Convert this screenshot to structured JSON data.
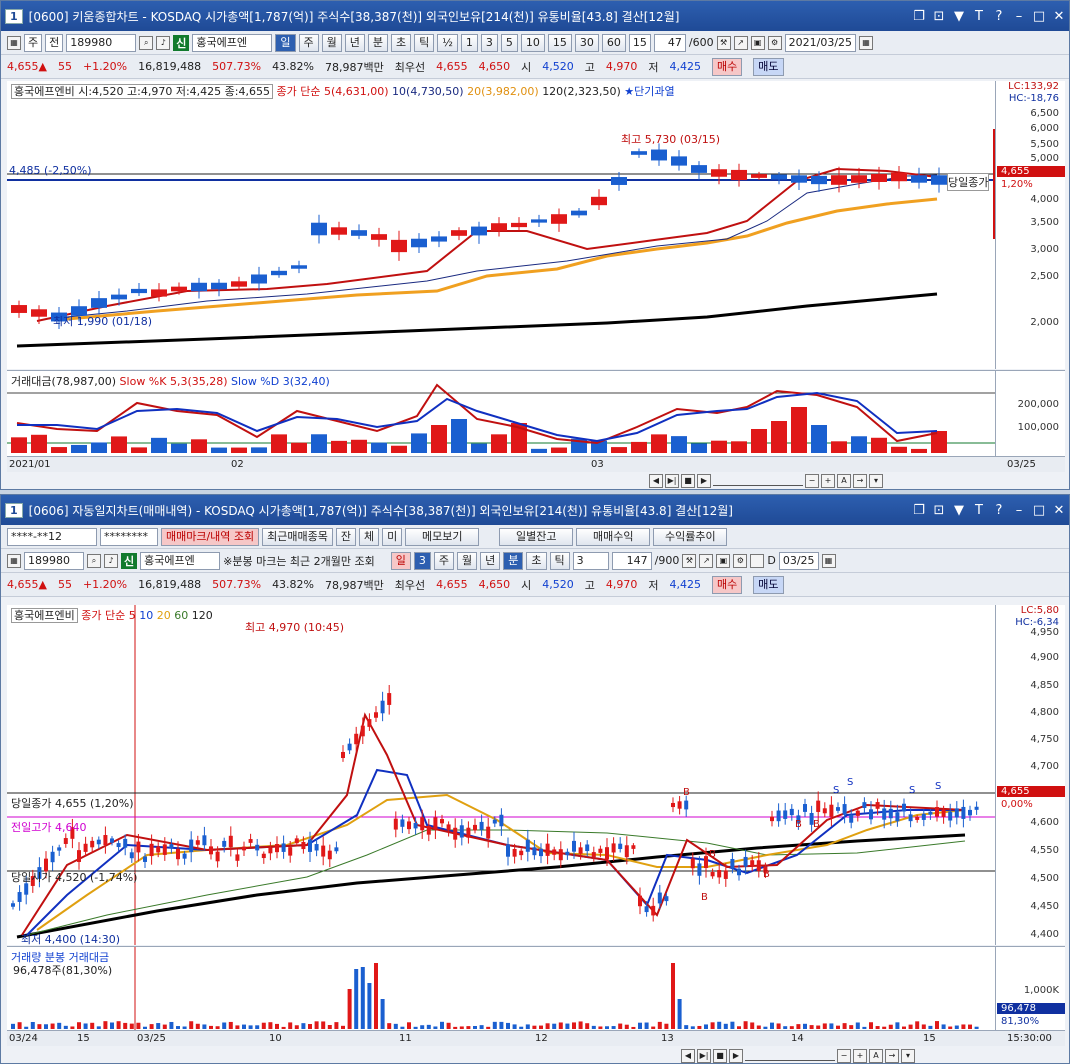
{
  "top": {
    "num": "1",
    "title": "[0600] 키움종합차트 - KOSDAQ 시가총액[1,787(억)] 주식수[38,387(천)] 외국인보유[214(천)] 유통비율[43.8] 결산[12월]",
    "tb": {
      "period": "주",
      "all": "전",
      "code": "189980",
      "badge": "신",
      "name": "홍국에프엔",
      "units": [
        "일",
        "주",
        "월",
        "년",
        "분",
        "초",
        "틱"
      ],
      "half": "½",
      "nums": [
        "1",
        "3",
        "5",
        "10",
        "15",
        "30",
        "60"
      ],
      "sel": "15",
      "count": "47",
      "countmax": "/600",
      "date": "2021/03/25"
    },
    "quote": {
      "price": "4,655▲",
      "chg": "55",
      "pct": "+1.20%",
      "vol": "16,819,488",
      "volpct": "507.73%",
      "ratio": "43.82%",
      "amt": "78,987백만",
      "best": "최우선",
      "ask": "4,655",
      "bid": "4,650",
      "open_l": "시",
      "open": "4,520",
      "high_l": "고",
      "high": "4,970",
      "low_l": "저",
      "low": "4,425",
      "buy": "매수",
      "sell": "매도"
    },
    "legend": {
      "name": "홍국에프엔비 시:4,520 고:4,970 저:4,425 종:4,655",
      "ma": "종가 단순 5(4,631,00)",
      "ma10": "10(4,730,50)",
      "ma20": "20(3,982,00)",
      "ma120": "120(2,323,50)",
      "star": "★단기과열"
    },
    "lc": "LC:133,92",
    "hc": "HC:-18,76",
    "yticks": [
      "6,500",
      "6,000",
      "5,500",
      "5,000",
      "4,000",
      "3,500",
      "3,000",
      "2,500",
      "2,000"
    ],
    "price_tag": "4,655",
    "pct_tag": "1,20%",
    "hline_label": "4,485 (-2,50%)",
    "high_ann": "최고 5,730 (03/15)",
    "low_ann": "최저 1,990 (01/18)",
    "right_ann": "당일종가",
    "sub_legend": {
      "a": "거래대금(78,987,00)",
      "b": "Slow %K 5,3(35,28)",
      "c": "Slow %D 3(32,40)"
    },
    "sub_yticks": [
      "200,000",
      "100,000"
    ],
    "x": [
      "2021/01",
      "02",
      "03",
      "03/25"
    ]
  },
  "bottom": {
    "num": "1",
    "title": "[0606] 자동일지차트(매매내역) - KOSDAQ 시가총액[1,787(억)] 주식수[38,387(천)] 외국인보유[214(천)] 유통비율[43.8] 결산[12월]",
    "r1": {
      "acct": "****-**12",
      "pw": "********",
      "b1": "매매마크/내역 조회",
      "b2": "최근매매종목",
      "b3": "잔",
      "b4": "체",
      "b5": "미",
      "b6": "메모보기",
      "b7": "일별잔고",
      "b8": "매매수익",
      "b9": "수익률추이"
    },
    "r2": {
      "code": "189980",
      "badge": "신",
      "name": "홍국에프엔",
      "note": "※분봉 마크는 최근 2개월만 조회",
      "day": "일",
      "n": "3",
      "units": [
        "주",
        "월",
        "년",
        "분",
        "초",
        "틱"
      ],
      "tick": "3",
      "count": "147",
      "countmax": "/900",
      "d": "D",
      "date": "03/25"
    },
    "quote": {
      "price": "4,655▲",
      "chg": "55",
      "pct": "+1.20%",
      "vol": "16,819,488",
      "volpct": "507.73%",
      "ratio": "43.82%",
      "amt": "78,987백만",
      "best": "최우선",
      "ask": "4,655",
      "bid": "4,650",
      "open_l": "시",
      "open": "4,520",
      "high_l": "고",
      "high": "4,970",
      "low_l": "저",
      "low": "4,425",
      "buy": "매수",
      "sell": "매도"
    },
    "legend": {
      "name": "홍국에프엔비",
      "ma": "종가 단순 5",
      "m10": "10",
      "m20": "20",
      "m60": "60",
      "m120": "120"
    },
    "lc": "LC:5,80",
    "hc": "HC:-6,34",
    "yticks": [
      "4,950",
      "4,900",
      "4,850",
      "4,800",
      "4,750",
      "4,700",
      "4,600",
      "4,550",
      "4,500",
      "4,450",
      "4,400"
    ],
    "price_tag": "4,655",
    "pct_tag": "0,00%",
    "high_ann": "최고 4,970 (10:45)",
    "low_ann": "최저 4,400 (14:30)",
    "close_ann": "당일종가 4,655 (1,20%)",
    "prevhigh_ann": "전일고가 4,640",
    "open_ann": "당일시가 4,520 (-1,74%)",
    "vol_legend": "거래량",
    "vol_legend2": "분봉 거래대금",
    "vol_value": "96,478주(81,30%)",
    "vol_ytick": "1,000K",
    "vol_tag": "96,478",
    "vol_tag2": "81,30%",
    "x": [
      "03/24",
      "15",
      "03/25",
      "10",
      "11",
      "12",
      "13",
      "14",
      "15",
      "15:30:00"
    ]
  }
}
